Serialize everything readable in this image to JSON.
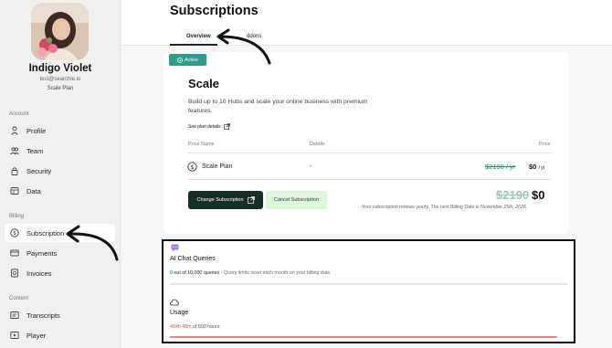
{
  "sidebar": {
    "user": {
      "name": "Indigo Violet",
      "email": "test@searchie.io",
      "plan": "Scale Plan"
    },
    "sections": {
      "account": "Account",
      "billing": "Billing",
      "content": "Content"
    },
    "items": [
      {
        "label": "Profile",
        "icon": "person-icon"
      },
      {
        "label": "Team",
        "icon": "team-icon"
      },
      {
        "label": "Security",
        "icon": "lock-icon"
      },
      {
        "label": "Data",
        "icon": "database-icon"
      },
      {
        "label": "Subscription",
        "icon": "dollar-icon",
        "active": true
      },
      {
        "label": "Payments",
        "icon": "card-icon"
      },
      {
        "label": "Invoices",
        "icon": "invoice-icon"
      },
      {
        "label": "Transcripts",
        "icon": "transcript-icon"
      },
      {
        "label": "Player",
        "icon": "player-icon"
      }
    ]
  },
  "header": {
    "title": "Subscriptions",
    "tabs": [
      {
        "label": "Overview",
        "active": true
      },
      {
        "label": "Addons",
        "visible_text": "ddons"
      }
    ]
  },
  "plan": {
    "status": "Active",
    "name": "Scale",
    "description": "Build up to 10 Hubs and scale your online business with premium features.",
    "details_link": "See plan details",
    "table_headers": {
      "name": "Price Name",
      "details": "Details",
      "price": "Price"
    },
    "row": {
      "name": "Scale Plan",
      "details": "-",
      "old_price": "$2190 / yr",
      "new_price": "$0",
      "period": "/ yr"
    },
    "change_button": "Change Subscription",
    "cancel_button": "Cancel Subscription",
    "total_old": "$2190",
    "total_new": "$0",
    "renew_text": "Your subscription renews yearly. The next Billing Date is",
    "renew_date": "November 25th, 2026."
  },
  "usage": {
    "ai": {
      "title": "AI Chat Queries",
      "used": "0",
      "limit_text": "out of 10,000 queries",
      "note": " - Query limits reset each month on your billing date.",
      "fraction": 0
    },
    "hours": {
      "title": "Usage",
      "used": "484h 48m",
      "limit_text": "of 500 hours",
      "fraction": 0.97
    }
  },
  "colors": {
    "accent": "#2e9e8a",
    "dark_button": "#163028",
    "light_button": "#dff5dc",
    "warning": "#d9534f"
  }
}
